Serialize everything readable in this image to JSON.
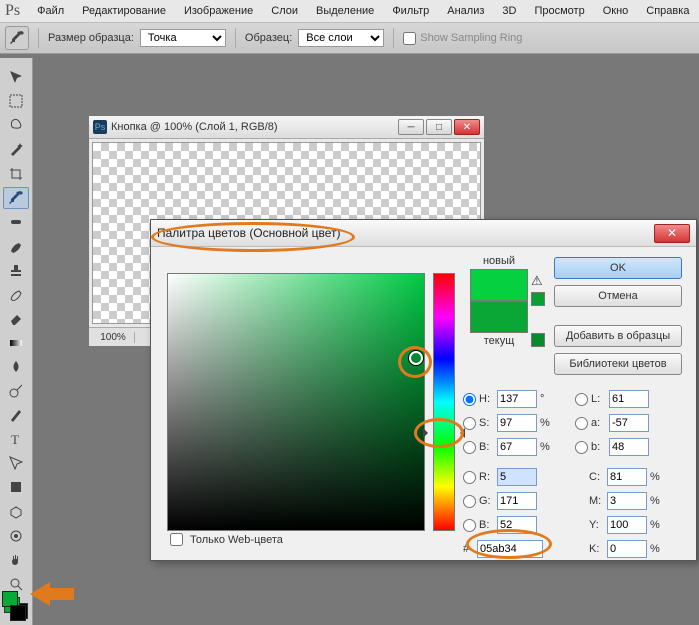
{
  "app_logo": "Ps",
  "menu": [
    "Файл",
    "Редактирование",
    "Изображение",
    "Слои",
    "Выделение",
    "Фильтр",
    "Анализ",
    "3D",
    "Просмотр",
    "Окно",
    "Справка"
  ],
  "options": {
    "sample_label": "Размер образца:",
    "sample_value": "Точка",
    "sample_src_label": "Образец:",
    "sample_src_value": "Все слои",
    "ring_label": "Show Sampling Ring"
  },
  "tools": [
    "move",
    "marquee",
    "lasso",
    "wand",
    "crop",
    "eyedropper",
    "heal",
    "brush",
    "stamp",
    "history",
    "eraser",
    "gradient",
    "blur",
    "dodge",
    "pen",
    "type",
    "path",
    "rect",
    "3d",
    "3dcam",
    "hand",
    "zoom"
  ],
  "doc": {
    "title": "Кнопка @ 100% (Слой 1, RGB/8)",
    "zoom": "100%"
  },
  "cp": {
    "title": "Палитра цветов (Основной цвет)",
    "new_label": "новый",
    "cur_label": "текущ",
    "ok": "OK",
    "cancel": "Отмена",
    "add": "Добавить в образцы",
    "libs": "Библиотеки цветов",
    "webonly": "Только Web-цвета",
    "hex_prefix": "#",
    "hex": "05ab34",
    "H": {
      "lab": "H:",
      "val": "137",
      "unit": "°"
    },
    "S": {
      "lab": "S:",
      "val": "97",
      "unit": "%"
    },
    "Bv": {
      "lab": "B:",
      "val": "67",
      "unit": "%"
    },
    "R": {
      "lab": "R:",
      "val": "5",
      "unit": ""
    },
    "G": {
      "lab": "G:",
      "val": "171",
      "unit": ""
    },
    "Bb": {
      "lab": "B:",
      "val": "52",
      "unit": ""
    },
    "L": {
      "lab": "L:",
      "val": "61",
      "unit": ""
    },
    "a": {
      "lab": "a:",
      "val": "-57",
      "unit": ""
    },
    "b": {
      "lab": "b:",
      "val": "48",
      "unit": ""
    },
    "C": {
      "lab": "C:",
      "val": "81",
      "unit": "%"
    },
    "M": {
      "lab": "M:",
      "val": "3",
      "unit": "%"
    },
    "Y": {
      "lab": "Y:",
      "val": "100",
      "unit": "%"
    },
    "K": {
      "lab": "K:",
      "val": "0",
      "unit": "%"
    }
  }
}
